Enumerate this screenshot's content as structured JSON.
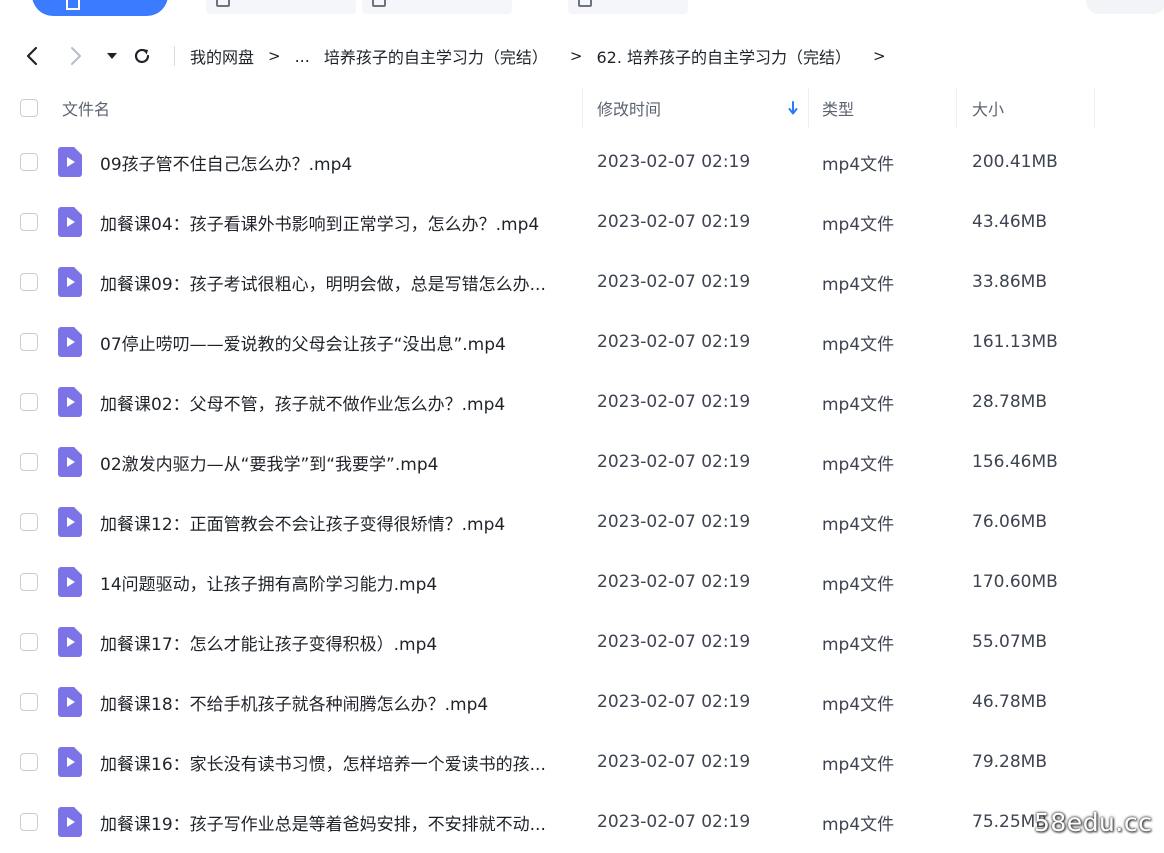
{
  "breadcrumb": {
    "root": "我的网盘",
    "ellipsis": "...",
    "parent": "培养孩子的自主学习力（完结）",
    "current": "62. 培养孩子的自主学习力（完结）",
    "separator": ">",
    "trailing": ">"
  },
  "columns": {
    "name": "文件名",
    "modified": "修改时间",
    "type": "类型",
    "size": "大小"
  },
  "sort": {
    "column": "modified",
    "direction": "descending"
  },
  "files": [
    {
      "name": "09孩子管不住自己怎么办？.mp4",
      "modified": "2023-02-07 02:19",
      "type": "mp4文件",
      "size": "200.41MB"
    },
    {
      "name": "加餐课04：孩子看课外书影响到正常学习，怎么办？.mp4",
      "modified": "2023-02-07 02:19",
      "type": "mp4文件",
      "size": "43.46MB"
    },
    {
      "name": "加餐课09：孩子考试很粗心，明明会做，总是写错怎么办...",
      "modified": "2023-02-07 02:19",
      "type": "mp4文件",
      "size": "33.86MB"
    },
    {
      "name": "07停止唠叨——爱说教的父母会让孩子“没出息”.mp4",
      "modified": "2023-02-07 02:19",
      "type": "mp4文件",
      "size": "161.13MB"
    },
    {
      "name": "加餐课02：父母不管，孩子就不做作业怎么办？.mp4",
      "modified": "2023-02-07 02:19",
      "type": "mp4文件",
      "size": "28.78MB"
    },
    {
      "name": "02激发内驱力—从“要我学”到“我要学”.mp4",
      "modified": "2023-02-07 02:19",
      "type": "mp4文件",
      "size": "156.46MB"
    },
    {
      "name": "加餐课12：正面管教会不会让孩子变得很矫情？.mp4",
      "modified": "2023-02-07 02:19",
      "type": "mp4文件",
      "size": "76.06MB"
    },
    {
      "name": "14问题驱动，让孩子拥有高阶学习能力.mp4",
      "modified": "2023-02-07 02:19",
      "type": "mp4文件",
      "size": "170.60MB"
    },
    {
      "name": "加餐课17：怎么才能让孩子变得积极）.mp4",
      "modified": "2023-02-07 02:19",
      "type": "mp4文件",
      "size": "55.07MB"
    },
    {
      "name": "加餐课18：不给手机孩子就各种闹腾怎么办？.mp4",
      "modified": "2023-02-07 02:19",
      "type": "mp4文件",
      "size": "46.78MB"
    },
    {
      "name": "加餐课16：家长没有读书习惯，怎样培养一个爱读书的孩...",
      "modified": "2023-02-07 02:19",
      "type": "mp4文件",
      "size": "79.28MB"
    },
    {
      "name": "加餐课19：孩子写作业总是等着爸妈安排，不安排就不动...",
      "modified": "2023-02-07 02:19",
      "type": "mp4文件",
      "size": "75.25MB"
    }
  ],
  "watermark": "58edu.cc",
  "colors": {
    "accent": "#3b7bff",
    "file_icon": "#7b73e6",
    "sort_arrow": "#2b7cf6"
  }
}
